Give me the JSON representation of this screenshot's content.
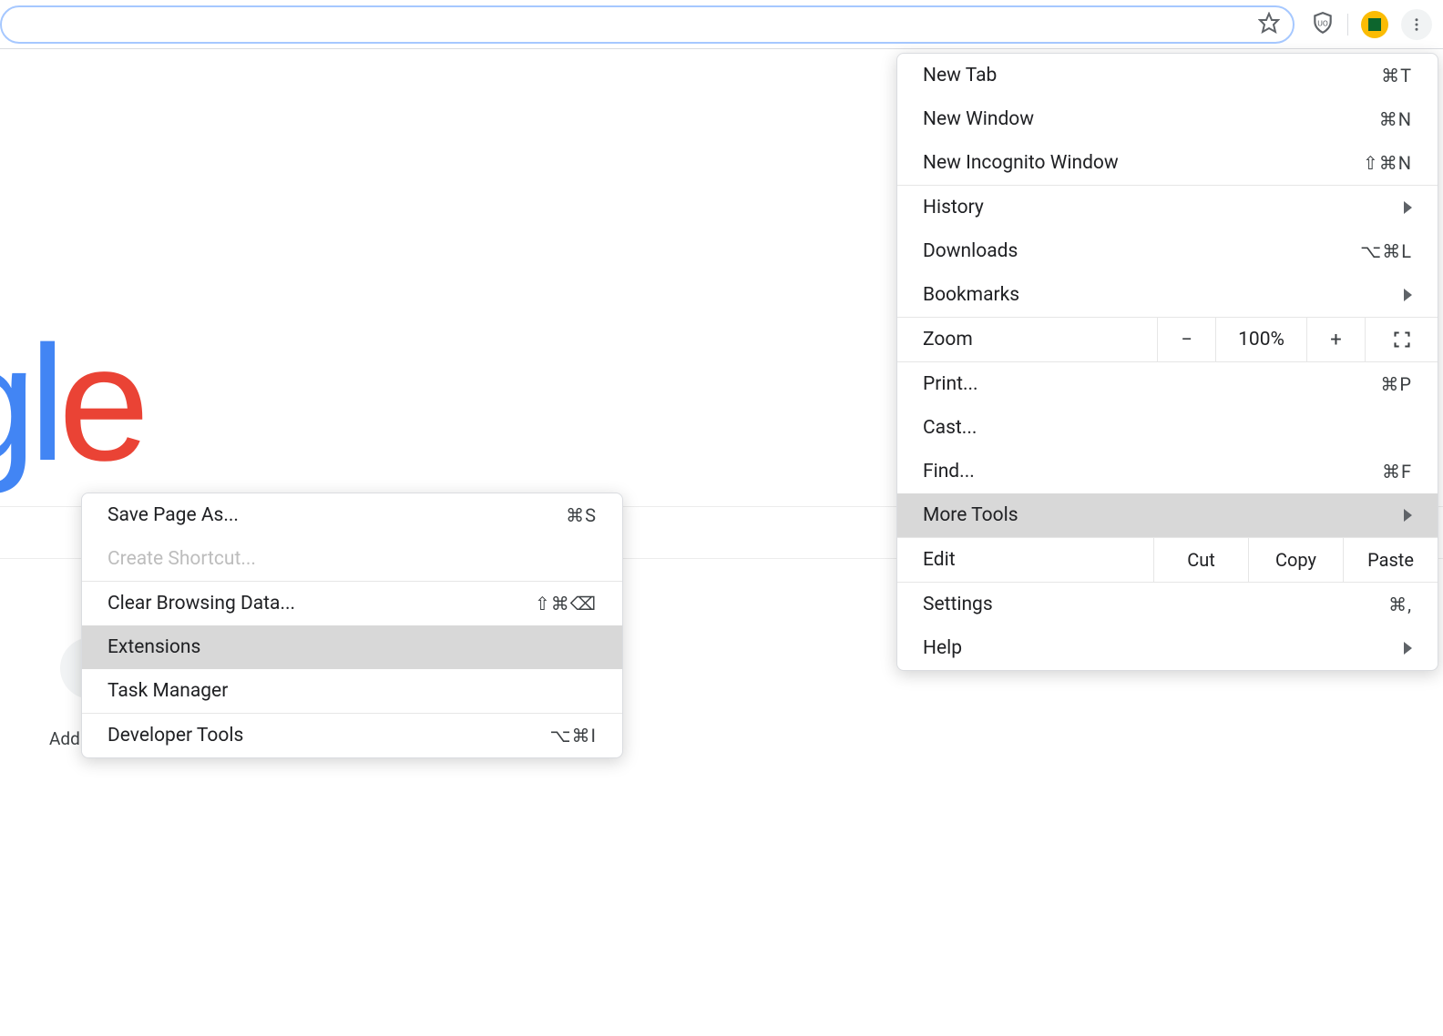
{
  "toolbar": {
    "star_title": "Bookmark this page",
    "shield_title": "uBlock Origin",
    "avatar_title": "Profile",
    "kebab_title": "Customize and control"
  },
  "logo": {
    "l1": "g",
    "l2": "l",
    "l3": "e"
  },
  "bg": {
    "add_text": "Add "
  },
  "menu": {
    "new_tab": "New Tab",
    "new_tab_sc": "⌘T",
    "new_window": "New Window",
    "new_window_sc": "⌘N",
    "new_incognito": "New Incognito Window",
    "new_incognito_sc": "⇧⌘N",
    "history": "History",
    "downloads": "Downloads",
    "downloads_sc": "⌥⌘L",
    "bookmarks": "Bookmarks",
    "zoom": "Zoom",
    "zoom_minus": "−",
    "zoom_pct": "100%",
    "zoom_plus": "+",
    "print": "Print...",
    "print_sc": "⌘P",
    "cast": "Cast...",
    "find": "Find...",
    "find_sc": "⌘F",
    "more_tools": "More Tools",
    "edit": "Edit",
    "cut": "Cut",
    "copy": "Copy",
    "paste": "Paste",
    "settings": "Settings",
    "settings_sc": "⌘,",
    "help": "Help"
  },
  "submenu": {
    "save_as": "Save Page As...",
    "save_as_sc": "⌘S",
    "create_shortcut": "Create Shortcut...",
    "clear_browsing": "Clear Browsing Data...",
    "clear_browsing_sc": "⇧⌘⌫",
    "extensions": "Extensions",
    "task_manager": "Task Manager",
    "dev_tools": "Developer Tools",
    "dev_tools_sc": "⌥⌘I"
  }
}
